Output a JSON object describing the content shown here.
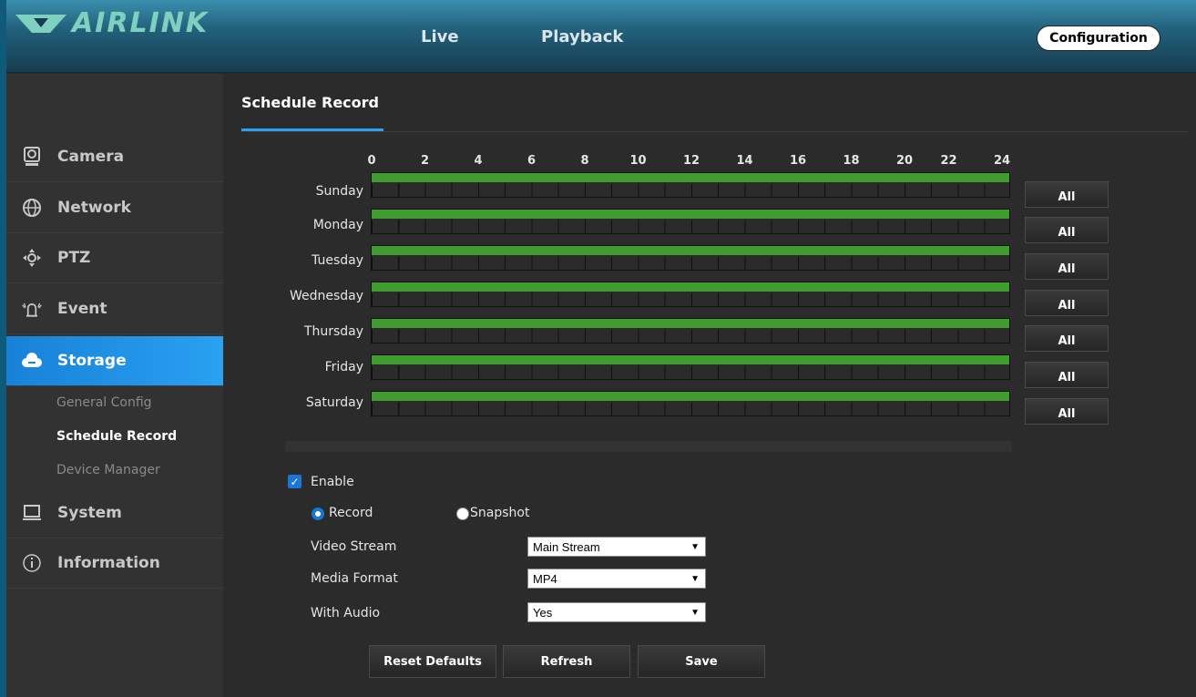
{
  "header": {
    "logo_text": "AIRLINK",
    "nav": {
      "live": "Live",
      "playback": "Playback"
    },
    "configuration": "Configuration"
  },
  "sidebar": {
    "items": [
      {
        "label": "Camera",
        "icon": "camera-icon"
      },
      {
        "label": "Network",
        "icon": "network-icon"
      },
      {
        "label": "PTZ",
        "icon": "ptz-icon"
      },
      {
        "label": "Event",
        "icon": "event-icon"
      },
      {
        "label": "Storage",
        "icon": "storage-icon",
        "active": true
      },
      {
        "label": "System",
        "icon": "system-icon"
      },
      {
        "label": "Information",
        "icon": "info-icon"
      }
    ],
    "storage_sub": [
      "General Config",
      "Schedule Record",
      "Device Manager"
    ],
    "storage_sub_current": "Schedule Record"
  },
  "main": {
    "title": "Schedule Record",
    "hours": [
      "0",
      "2",
      "4",
      "6",
      "8",
      "10",
      "12",
      "14",
      "16",
      "18",
      "20",
      "22",
      "24"
    ],
    "days": [
      {
        "name": "Sunday",
        "all": "All",
        "record_from": 0,
        "record_to": 24
      },
      {
        "name": "Monday",
        "all": "All",
        "record_from": 0,
        "record_to": 24
      },
      {
        "name": "Tuesday",
        "all": "All",
        "record_from": 0,
        "record_to": 24
      },
      {
        "name": "Wednesday",
        "all": "All",
        "record_from": 0,
        "record_to": 24
      },
      {
        "name": "Thursday",
        "all": "All",
        "record_from": 0,
        "record_to": 24
      },
      {
        "name": "Friday",
        "all": "All",
        "record_from": 0,
        "record_to": 24
      },
      {
        "name": "Saturday",
        "all": "All",
        "record_from": 0,
        "record_to": 24
      }
    ],
    "enable_label": "Enable",
    "enable_checked": true,
    "mode": {
      "record": "Record",
      "snapshot": "Snapshot",
      "selected": "Record"
    },
    "video_stream": {
      "label": "Video Stream",
      "value": "Main Stream"
    },
    "media_format": {
      "label": "Media Format",
      "value": "MP4"
    },
    "with_audio": {
      "label": "With Audio",
      "value": "Yes"
    },
    "buttons": {
      "reset": "Reset Defaults",
      "refresh": "Refresh",
      "save": "Save"
    }
  },
  "colors": {
    "accent": "#2aa1f2",
    "record_bar": "#3f9a30",
    "header": "#23617c"
  }
}
